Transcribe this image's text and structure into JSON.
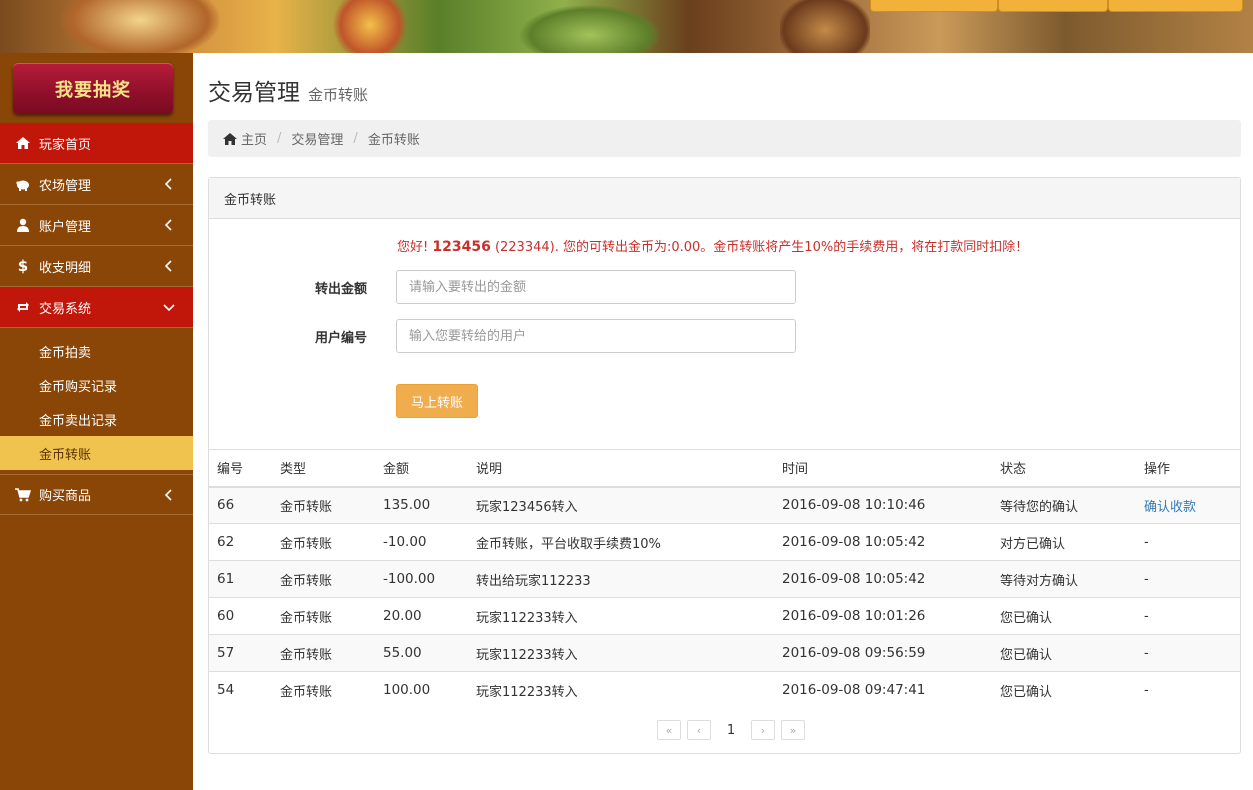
{
  "sidebar": {
    "lottery_label": "我要抽奖",
    "items": [
      {
        "label": "玩家首页",
        "icon": "home-icon",
        "active": true
      },
      {
        "label": "农场管理",
        "icon": "piggy-icon"
      },
      {
        "label": "账户管理",
        "icon": "user-icon"
      },
      {
        "label": "收支明细",
        "icon": "dollar-icon"
      },
      {
        "label": "交易系统",
        "icon": "retweet-icon",
        "active": true,
        "expanded": true
      },
      {
        "label": "购买商品",
        "icon": "cart-icon"
      }
    ],
    "sub_items": [
      {
        "label": "金币拍卖"
      },
      {
        "label": "金币购买记录"
      },
      {
        "label": "金币卖出记录"
      },
      {
        "label": "金币转账",
        "active": true
      }
    ]
  },
  "header": {
    "title": "交易管理",
    "subtitle": "金币转账"
  },
  "breadcrumb": {
    "home": "主页",
    "level1": "交易管理",
    "level2": "金币转账"
  },
  "panel": {
    "title": "金币转账",
    "notice_prefix": "您好!",
    "notice_user": "123456",
    "notice_rest": " (223344). 您的可转出金币为:0.00。金币转账将产生10%的手续费用，将在打款同时扣除！",
    "amount_label": "转出金额",
    "amount_placeholder": "请输入要转出的金额",
    "user_label": "用户编号",
    "user_placeholder": "输入您要转给的用户",
    "submit_label": "马上转账"
  },
  "table": {
    "headers": [
      "编号",
      "类型",
      "金额",
      "说明",
      "时间",
      "状态",
      "操作"
    ],
    "rows": [
      {
        "id": "66",
        "type": "金币转账",
        "amount": "135.00",
        "desc": "玩家123456转入",
        "time": "2016-09-08 10:10:46",
        "status": "等待您的确认",
        "op": "确认收款"
      },
      {
        "id": "62",
        "type": "金币转账",
        "amount": "-10.00",
        "desc": "金币转账，平台收取手续费10%",
        "time": "2016-09-08 10:05:42",
        "status": "对方已确认",
        "op": "-"
      },
      {
        "id": "61",
        "type": "金币转账",
        "amount": "-100.00",
        "desc": "转出给玩家112233",
        "time": "2016-09-08 10:05:42",
        "status": "等待对方确认",
        "op": "-"
      },
      {
        "id": "60",
        "type": "金币转账",
        "amount": "20.00",
        "desc": "玩家112233转入",
        "time": "2016-09-08 10:01:26",
        "status": "您已确认",
        "op": "-"
      },
      {
        "id": "57",
        "type": "金币转账",
        "amount": "55.00",
        "desc": "玩家112233转入",
        "time": "2016-09-08 09:56:59",
        "status": "您已确认",
        "op": "-"
      },
      {
        "id": "54",
        "type": "金币转账",
        "amount": "100.00",
        "desc": "玩家112233转入",
        "time": "2016-09-08 09:47:41",
        "status": "您已确认",
        "op": "-"
      }
    ]
  },
  "pager": {
    "first": "«",
    "prev": "‹",
    "current": "1",
    "next": "›",
    "last": "»"
  },
  "colors": {
    "sidebar_bg": "#8a4607",
    "active_nav": "#c1170b",
    "active_sub": "#f0c24e",
    "notice_red": "#c9302c",
    "button_orange": "#f0ad4e",
    "link_blue": "#337ab7"
  }
}
